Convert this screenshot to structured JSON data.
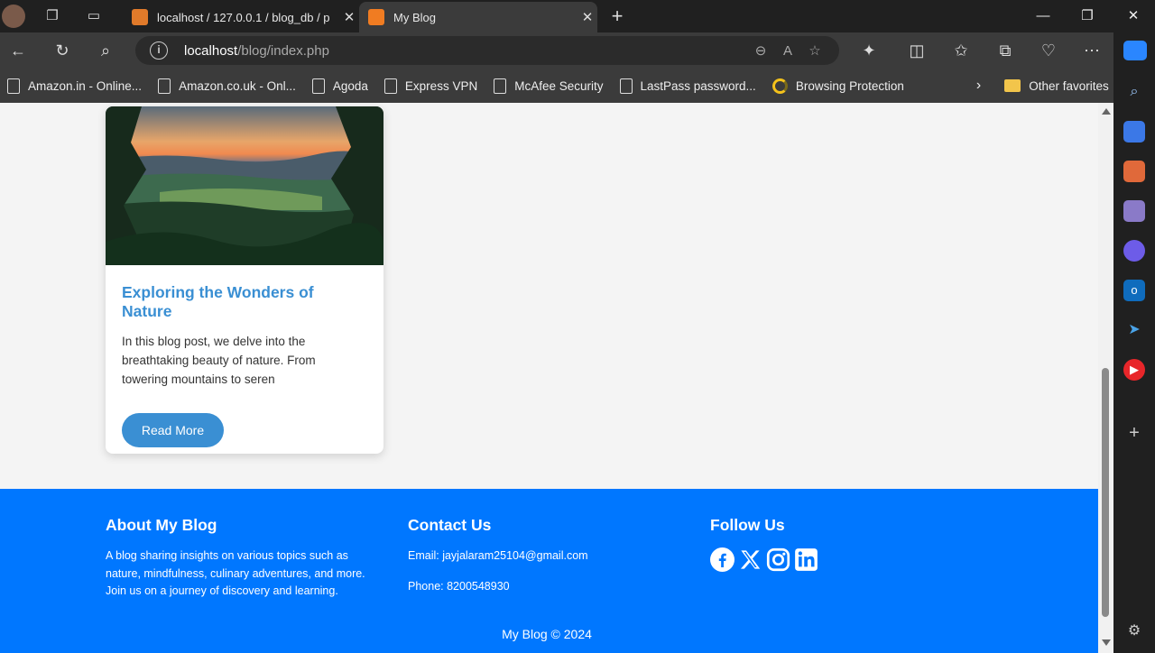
{
  "browser": {
    "tabs": [
      {
        "title": "localhost / 127.0.0.1 / blog_db / p",
        "active": false,
        "favicon": "phpmyadmin-icon"
      },
      {
        "title": "My Blog",
        "active": true,
        "favicon": "xampp-icon"
      }
    ],
    "address": {
      "host": "localhost",
      "path": "/blog/index.php"
    },
    "bookmarks": [
      {
        "label": "Amazon.in - Online...",
        "icon": "page-icon"
      },
      {
        "label": "Amazon.co.uk - Onl...",
        "icon": "page-icon"
      },
      {
        "label": "Agoda",
        "icon": "page-icon"
      },
      {
        "label": "Express VPN",
        "icon": "page-icon"
      },
      {
        "label": "McAfee Security",
        "icon": "page-icon"
      },
      {
        "label": "LastPass password...",
        "icon": "page-icon"
      },
      {
        "label": "Browsing Protection",
        "icon": "shield-ring-icon"
      }
    ],
    "other_favorites": "Other favorites"
  },
  "post": {
    "title": "Exploring the Wonders of Nature",
    "excerpt": "In this blog post, we delve into the breathtaking beauty of nature. From towering mountains to seren",
    "read_more": "Read More"
  },
  "footer": {
    "about": {
      "heading": "About My Blog",
      "text": "A blog sharing insights on various topics such as nature, mindfulness, culinary adventures, and more. Join us on a journey of discovery and learning."
    },
    "contact": {
      "heading": "Contact Us",
      "email": "Email: jayjalaram25104@gmail.com",
      "phone": "Phone: 8200548930"
    },
    "follow": {
      "heading": "Follow Us",
      "networks": [
        "facebook",
        "x",
        "instagram",
        "linkedin"
      ]
    },
    "copyright": "My Blog © 2024"
  },
  "colors": {
    "footer_bg": "#0077ff",
    "accent": "#3a8fd3",
    "page_bg": "#f4f4f4"
  }
}
